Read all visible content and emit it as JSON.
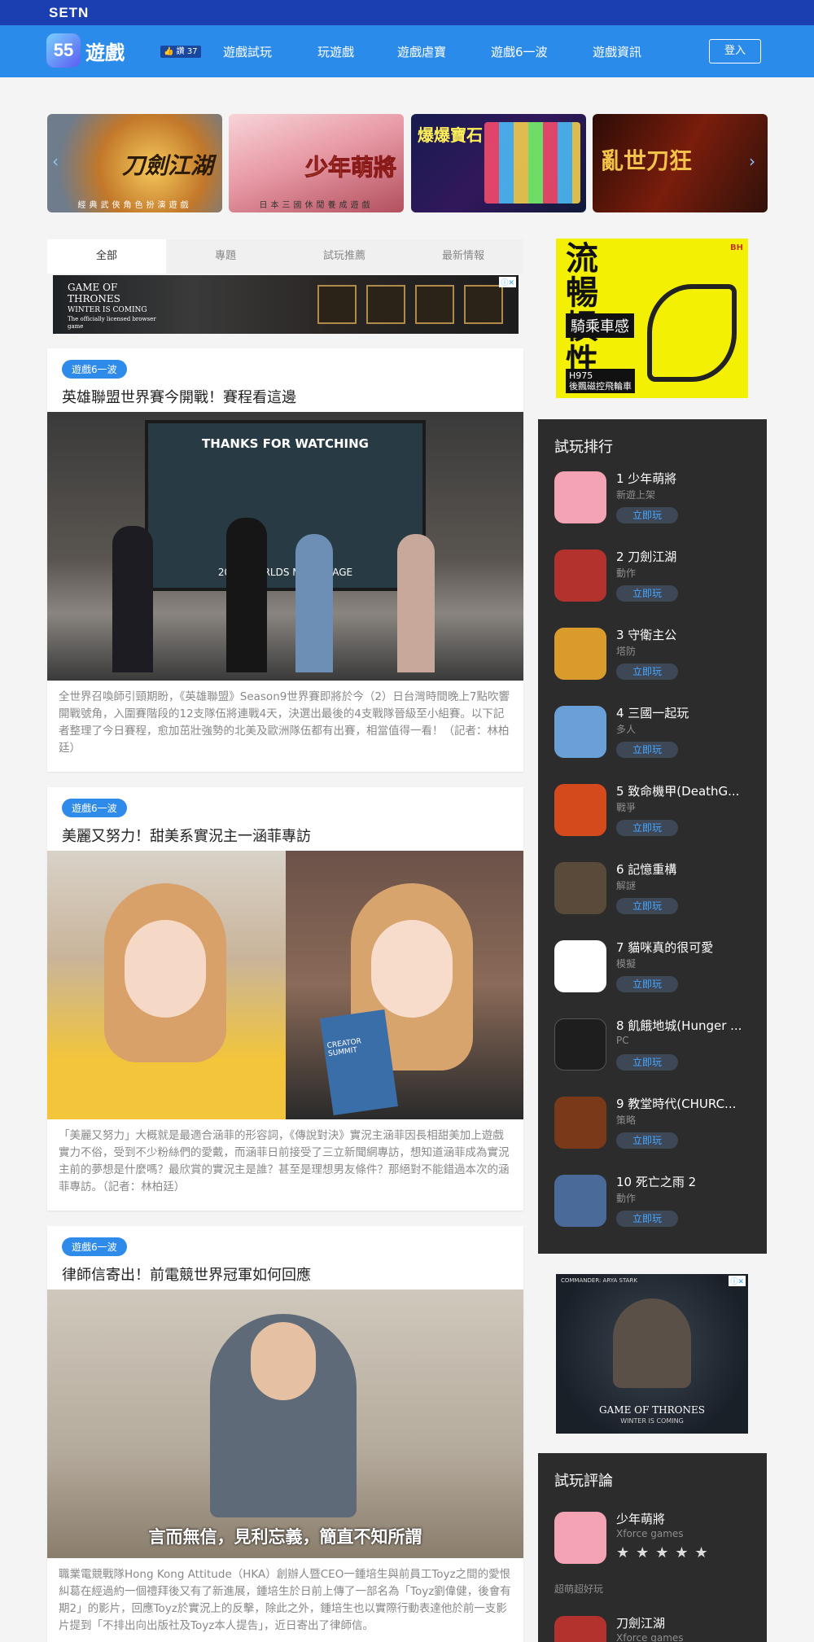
{
  "header": {
    "network_logo": "SETN",
    "brand_badge": "55",
    "brand_text": "遊戲",
    "like_count": "讚 37",
    "nav": [
      "遊戲試玩",
      "玩遊戲",
      "遊戲虐寶",
      "遊戲6一波",
      "遊戲資訊"
    ],
    "login": "登入"
  },
  "banners": [
    {
      "title": "刀劍江湖",
      "caption": "經典武俠角色扮演遊戲"
    },
    {
      "title": "少年萌將",
      "caption": "日本三國休閒養成遊戲"
    },
    {
      "title": "爆爆寶石",
      "caption": ""
    },
    {
      "title": "亂世刀狂",
      "caption": ""
    }
  ],
  "tabs": [
    "全部",
    "專題",
    "試玩推薦",
    "最新情報"
  ],
  "top_ad": {
    "title": "GAME OF THRONES",
    "subtitle": "WINTER IS COMING",
    "tagline": "The officially licensed browser game"
  },
  "articles": [
    {
      "tag": "遊戲6一波",
      "title": "英雄聯盟世界賽今開戰！賽程看這邊",
      "image_text": "THANKS FOR WATCHING",
      "image_sub": "2019 WORLDS MAIN STAGE",
      "desc": "全世界召喚師引頸期盼，《英雄聯盟》Season9世界賽即將於今（2）日台灣時間晚上7點吹響開戰號角，入圍賽階段的12支隊伍將連戰4天，決選出最後的4支戰隊晉級至小組賽。以下記者整理了今日賽程，愈加茁壯強勢的北美及歐洲隊伍都有出賽，相當值得一看！（記者：林柏廷）"
    },
    {
      "tag": "遊戲6一波",
      "title": "美麗又努力！甜美系實況主一涵菲專訪",
      "image_text": "CREATOR SUMMIT",
      "image_sub": "",
      "desc": "「美麗又努力」大概就是最適合涵菲的形容詞，《傳說對決》實況主涵菲因長相甜美加上遊戲實力不俗，受到不少粉絲們的愛戴，而涵菲日前接受了三立新聞網專訪，想知道涵菲成為實況主前的夢想是什麼嗎？最欣賞的實況主是誰？甚至是理想男友條件？那絕對不能錯過本次的涵菲專訪。（記者：林柏廷）"
    },
    {
      "tag": "遊戲6一波",
      "title": "律師信寄出！前電競世界冠軍如何回應",
      "image_text": "言而無信，見利忘義，簡直不知所謂",
      "image_sub": "",
      "desc": "職業電競戰隊Hong Kong Attitude（HKA）創辦人暨CEO一鍾培生與前員工Toyz之間的愛恨糾葛在經過約一個禮拜後又有了新進展，鍾培生於日前上傳了一部名為「Toyz劉偉健，後會有期2」的影片，回應Toyz於實況上的反擊，除此之外，鍾培生也以實際行動表達他於前一支影片提到「不排出向出版社及Toyz本人提告」，近日寄出了律師信。"
    }
  ],
  "side_ad_1": {
    "headline": "流暢慣性",
    "sub": "騎乘車感",
    "model": "H975",
    "model_desc": "後飄磁控飛輪車",
    "brand": "BH"
  },
  "ranking": {
    "title": "試玩排行",
    "play_label": "立即玩",
    "items": [
      {
        "name": "1 少年萌將",
        "cat": "新遊上架",
        "color": "#f4a3b4"
      },
      {
        "name": "2 刀劍江湖",
        "cat": "動作",
        "color": "#b3322d"
      },
      {
        "name": "3 守衛主公",
        "cat": "塔防",
        "color": "#d99b2c"
      },
      {
        "name": "4 三國一起玩",
        "cat": "多人",
        "color": "#6aa0d8"
      },
      {
        "name": "5 致命機甲(DeathG...",
        "cat": "戰爭",
        "color": "#d54a1c"
      },
      {
        "name": "6 記憶重構",
        "cat": "解謎",
        "color": "#5a4a3a"
      },
      {
        "name": "7 貓咪真的很可愛",
        "cat": "模擬",
        "color": "#ffffff"
      },
      {
        "name": "8 飢餓地城(Hunger ...",
        "cat": "PC",
        "color": "#2a2a2a"
      },
      {
        "name": "9 教堂時代(CHURC...",
        "cat": "策略",
        "color": "#7a3a1a"
      },
      {
        "name": "10 死亡之雨 2",
        "cat": "動作",
        "color": "#4a6a9a"
      }
    ]
  },
  "side_ad_2": {
    "commander": "COMMANDER: ARYA STARK",
    "title": "GAME OF THRONES",
    "subtitle": "WINTER IS COMING"
  },
  "review": {
    "title": "試玩評論",
    "items": [
      {
        "name": "少年萌將",
        "publisher": "Xforce games",
        "stars": "★★★★★",
        "comment": "超萌超好玩"
      },
      {
        "name": "刀劍江湖",
        "publisher": "Xforce games"
      }
    ]
  }
}
